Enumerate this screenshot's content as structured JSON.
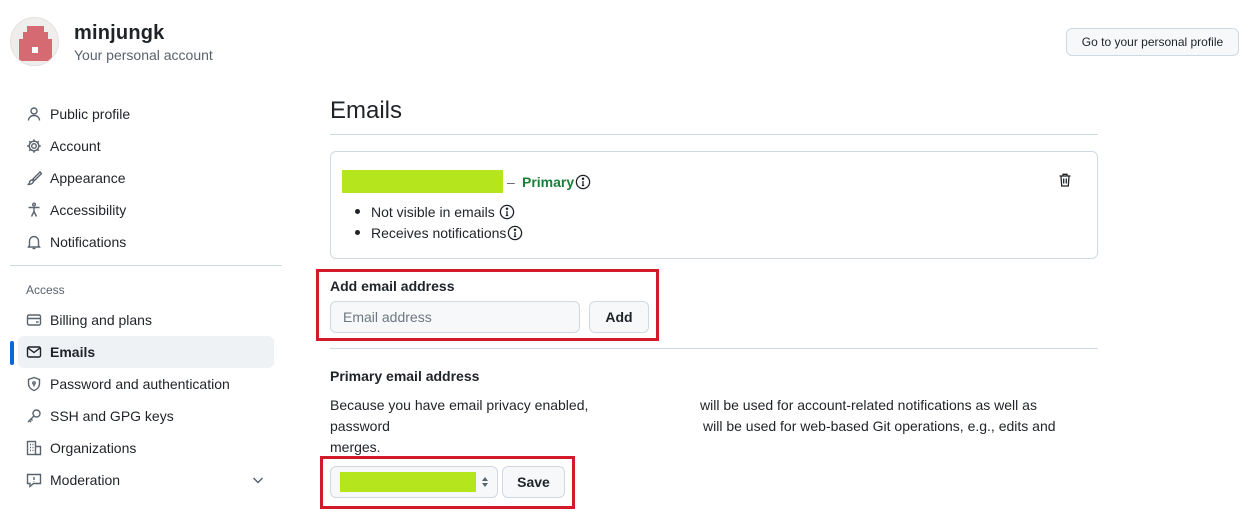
{
  "header": {
    "username": "minjungk",
    "subtitle": "Your personal account",
    "profile_button": "Go to your personal profile"
  },
  "sidebar": {
    "items": [
      {
        "label": "Public profile",
        "icon": "person-icon"
      },
      {
        "label": "Account",
        "icon": "gear-icon"
      },
      {
        "label": "Appearance",
        "icon": "paintbrush-icon"
      },
      {
        "label": "Accessibility",
        "icon": "accessibility-icon"
      },
      {
        "label": "Notifications",
        "icon": "bell-icon"
      }
    ],
    "access_heading": "Access",
    "access_items": [
      {
        "label": "Billing and plans",
        "icon": "credit-card-icon"
      },
      {
        "label": "Emails",
        "icon": "mail-icon",
        "selected": true
      },
      {
        "label": "Password and authentication",
        "icon": "shield-lock-icon"
      },
      {
        "label": "SSH and GPG keys",
        "icon": "key-icon"
      },
      {
        "label": "Organizations",
        "icon": "organization-icon"
      },
      {
        "label": "Moderation",
        "icon": "report-icon"
      }
    ]
  },
  "main": {
    "title": "Emails",
    "email_entry": {
      "separator": "–",
      "badge": "Primary",
      "bullets": [
        "Not visible in emails",
        "Receives notifications"
      ]
    },
    "add_email": {
      "heading": "Add email address",
      "placeholder": "Email address",
      "button": "Add"
    },
    "primary_email": {
      "heading": "Primary email address",
      "line1_a": "Because you have email privacy enabled,",
      "line1_b": "will be used for account-related notifications as well as",
      "line2_a": "password",
      "line2_b": "will be used for web-based Git operations, e.g., edits and",
      "line3": "merges.",
      "save_button": "Save"
    }
  },
  "colors": {
    "accent": "#0969da",
    "primary_badge": "#1a7f37",
    "redaction": "#b5e61d",
    "highlight": "#d11a2a"
  }
}
